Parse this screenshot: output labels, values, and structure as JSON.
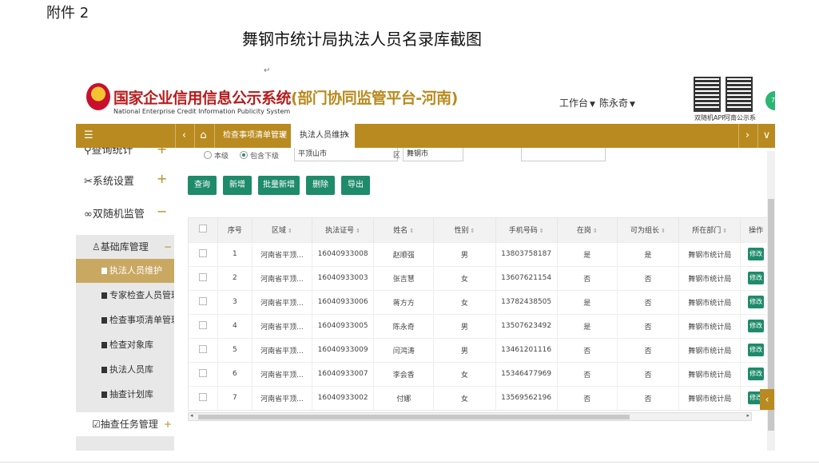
{
  "document": {
    "attachment_label": "附件 2",
    "title": "舞钢市统计局执法人员名录库截图",
    "para_mark": "↵"
  },
  "header": {
    "system_title": "国家企业信用信息公示系统",
    "system_subtitle": "(部门协同监管平台-河南)",
    "system_title_en": "National Enterprise Credit Information Publicity System",
    "workbench_label": "工作台",
    "user_name": "陈永奇",
    "qr_caption_1": "双随机APP",
    "qr_caption_2": "河南公示系",
    "orb_text": "73"
  },
  "tabbar": {
    "menu_icon": "☰",
    "prev_icon": "‹",
    "home_icon": "⌂",
    "tabs": [
      {
        "label": "检查事项清单管理",
        "close": "x"
      },
      {
        "label": "执法人员维护",
        "close": "x"
      }
    ],
    "next_icon": "›",
    "dropdown_icon": "∨"
  },
  "sidebar": {
    "items": [
      {
        "label": "查询统计",
        "sign": "+"
      },
      {
        "label": "系统设置",
        "sign": "+"
      },
      {
        "label": "双随机监管",
        "sign": "−"
      }
    ],
    "group_head": {
      "label": "基础库管理",
      "sign": "−"
    },
    "sub_items": [
      "执法人员维护",
      "专家检查人员管理",
      "检查事项清单管理",
      "检查对象库",
      "执法人员库",
      "抽查计划库"
    ],
    "task_head": {
      "label": "抽查任务管理",
      "sign": "+"
    }
  },
  "filters": {
    "radio_1": "本级",
    "radio_2": "包含下级",
    "field_1": "平顶山市",
    "label_2": "区",
    "field_2": "舞钢市"
  },
  "toolbar": {
    "query": "查询",
    "add": "新增",
    "batch_add": "批量新增",
    "delete": "删除",
    "export": "导出"
  },
  "table": {
    "headers": [
      "序号",
      "区域",
      "执法证号",
      "姓名",
      "性别",
      "手机号码",
      "在岗",
      "可为组长",
      "所在部门",
      "操作"
    ],
    "rows": [
      [
        "1",
        "河南省平顶...",
        "16040933008",
        "赵顺强",
        "男",
        "13803758187",
        "是",
        "是",
        "舞钢市统计局",
        "修改"
      ],
      [
        "2",
        "河南省平顶...",
        "16040933003",
        "张吉慧",
        "女",
        "13607621154",
        "否",
        "否",
        "舞钢市统计局",
        "修改"
      ],
      [
        "3",
        "河南省平顶...",
        "16040933006",
        "蒋方方",
        "女",
        "13782438505",
        "是",
        "否",
        "舞钢市统计局",
        "修改"
      ],
      [
        "4",
        "河南省平顶...",
        "16040933005",
        "陈永奇",
        "男",
        "13507623492",
        "是",
        "否",
        "舞钢市统计局",
        "修改"
      ],
      [
        "5",
        "河南省平顶...",
        "16040933009",
        "闫鸿涛",
        "男",
        "13461201116",
        "否",
        "否",
        "舞钢市统计局",
        "修改"
      ],
      [
        "6",
        "河南省平顶...",
        "16040933007",
        "李会香",
        "女",
        "15346477969",
        "否",
        "否",
        "舞钢市统计局",
        "修改"
      ],
      [
        "7",
        "河南省平顶...",
        "16040933002",
        "付娜",
        "女",
        "13569562196",
        "否",
        "否",
        "舞钢市统计局",
        "修改"
      ]
    ]
  },
  "side_arrow": "‹",
  "colors": {
    "gold": "#b98a1f",
    "green": "#1e8b6a",
    "red": "#b51d1d"
  }
}
